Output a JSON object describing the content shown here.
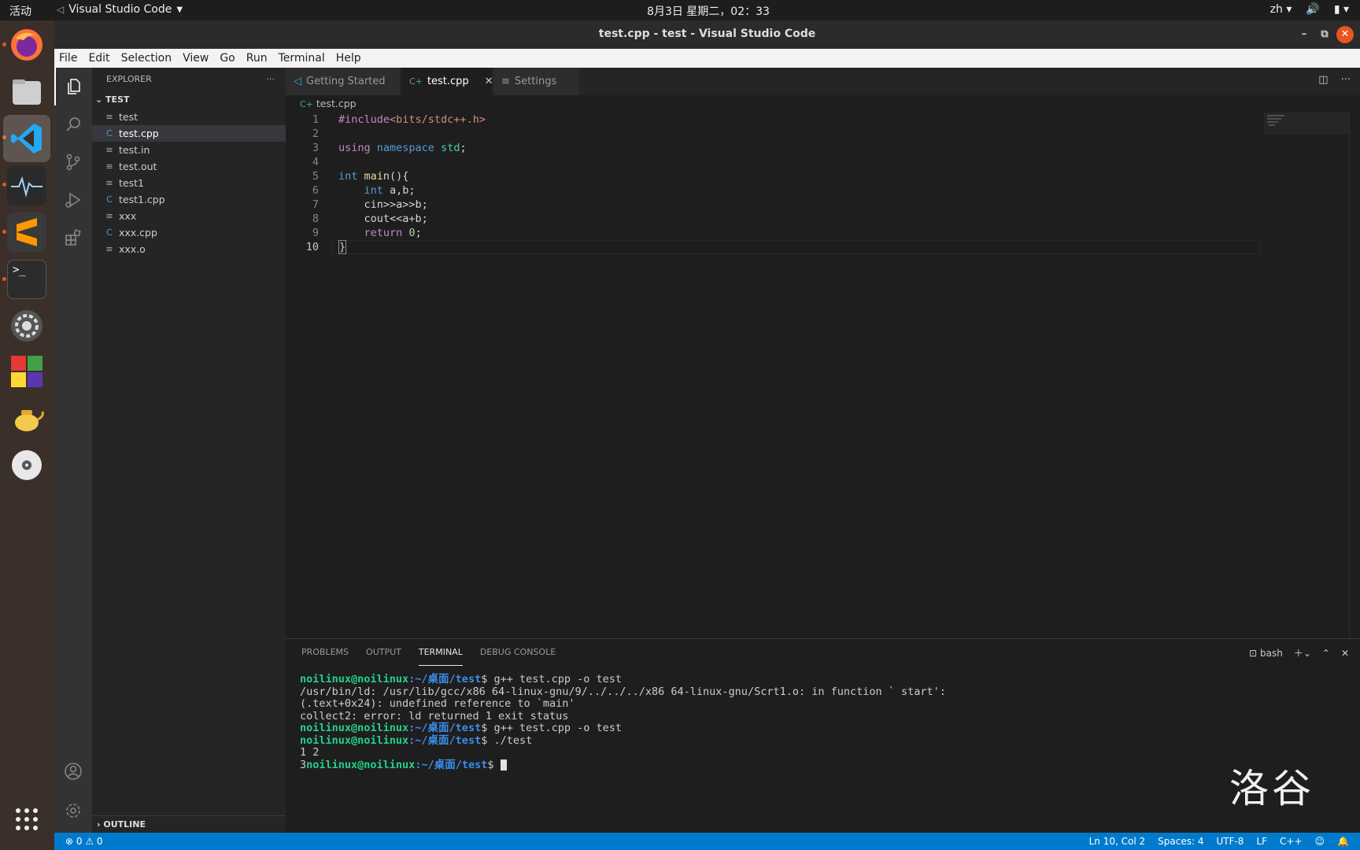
{
  "system_bar": {
    "activities": "活动",
    "app_name": "Visual Studio Code",
    "clock": "8月3日 星期二，02：33",
    "input_method": "zh"
  },
  "window": {
    "title": "test.cpp - test - Visual Studio Code"
  },
  "menu": [
    "File",
    "Edit",
    "Selection",
    "View",
    "Go",
    "Run",
    "Terminal",
    "Help"
  ],
  "explorer": {
    "header": "EXPLORER",
    "root": "TEST",
    "files": [
      {
        "name": "test",
        "icon": "file-lines-icon",
        "selected": false
      },
      {
        "name": "test.cpp",
        "icon": "cpp-icon",
        "selected": true
      },
      {
        "name": "test.in",
        "icon": "file-lines-icon",
        "selected": false
      },
      {
        "name": "test.out",
        "icon": "file-lines-icon",
        "selected": false
      },
      {
        "name": "test1",
        "icon": "file-lines-icon",
        "selected": false
      },
      {
        "name": "test1.cpp",
        "icon": "cpp-icon",
        "selected": false
      },
      {
        "name": "xxx",
        "icon": "file-lines-icon",
        "selected": false
      },
      {
        "name": "xxx.cpp",
        "icon": "cpp-icon",
        "selected": false
      },
      {
        "name": "xxx.o",
        "icon": "file-lines-icon",
        "selected": false
      }
    ],
    "outline": "OUTLINE"
  },
  "tabs": [
    {
      "label": "Getting Started",
      "active": false
    },
    {
      "label": "test.cpp",
      "active": true
    },
    {
      "label": "Settings",
      "active": false
    }
  ],
  "breadcrumb": "test.cpp",
  "code_lines": [
    "#include<bits/stdc++.h>",
    "",
    "using namespace std;",
    "",
    "int main(){",
    "    int a,b;",
    "    cin>>a>>b;",
    "    cout<<a+b;",
    "    return 0;",
    "}"
  ],
  "current_line": 10,
  "panel": {
    "tabs": [
      "PROBLEMS",
      "OUTPUT",
      "TERMINAL",
      "DEBUG CONSOLE"
    ],
    "active_tab": "TERMINAL",
    "shell": "bash",
    "terminal": {
      "prompt_user": "noilinux@noilinux",
      "prompt_path": ":~/桌面/test",
      "lines": [
        {
          "type": "prompt",
          "cmd": "$ g++ test.cpp -o test"
        },
        {
          "type": "out",
          "text": "/usr/bin/ld: /usr/lib/gcc/x86 64-linux-gnu/9/../../../x86 64-linux-gnu/Scrt1.o: in function ` start':"
        },
        {
          "type": "out",
          "text": "(.text+0x24): undefined reference to `main'"
        },
        {
          "type": "out",
          "text": "collect2: error: ld returned 1 exit status"
        },
        {
          "type": "prompt",
          "cmd": "$ g++ test.cpp -o test"
        },
        {
          "type": "prompt",
          "cmd": "$ ./test"
        },
        {
          "type": "out",
          "text": "1 2"
        }
      ],
      "last_prefix": "3",
      "last_cmd": "$ "
    }
  },
  "watermark": "洛谷",
  "status": {
    "problems": "⊗ 0 ⚠ 0",
    "position": "Ln 10, Col 2",
    "spaces": "Spaces: 4",
    "encoding": "UTF-8",
    "eol": "LF",
    "language": "C++"
  },
  "colors": {
    "accent": "#007acc",
    "ubuntu_orange": "#e95420"
  }
}
